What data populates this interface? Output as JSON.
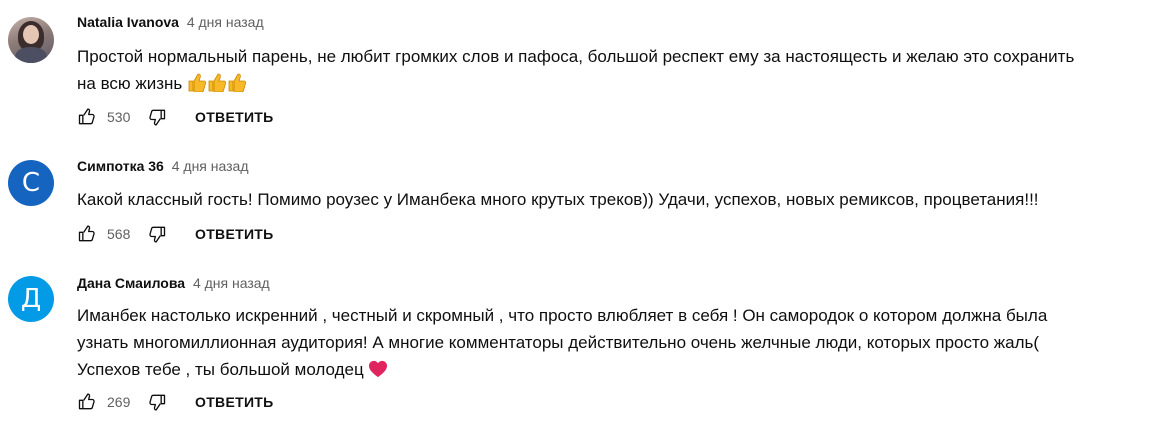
{
  "comments": [
    {
      "author": "Natalia Ivanova",
      "time": "4 дня назад",
      "avatar": {
        "type": "photo"
      },
      "lines": [
        "Простой нормальный парень, не любит громких слов и пафоса, большой респект ему за настоящесть и желаю это сохранить",
        "на всю жизнь"
      ],
      "emoji": "thumbs-up x3",
      "likes": "530",
      "reply_label": "ОТВЕТИТЬ"
    },
    {
      "author": "Симпотка 36",
      "time": "4 дня назад",
      "avatar": {
        "type": "letter",
        "letter": "С",
        "color": "#1565c0"
      },
      "lines": [
        "Какой классный гость! Помимо роузес у Иманбека много крутых треков)) Удачи,  успехов, новых ремиксов, процветания!!!"
      ],
      "likes": "568",
      "reply_label": "ОТВЕТИТЬ"
    },
    {
      "author": "Дана Смаилова",
      "time": "4 дня назад",
      "avatar": {
        "type": "letter",
        "letter": "Д",
        "color": "#039be5"
      },
      "lines": [
        "Иманбек настолько искренний , честный и скромный , что просто влюбляет в себя ! Он самородок о котором должна была",
        "узнать многомиллионная аудитория! А многие комментаторы действительно очень желчные люди, которых просто жаль(",
        "Успехов тебе , ты большой молодец"
      ],
      "emoji": "red-heart",
      "likes": "269",
      "reply_label": "ОТВЕТИТЬ"
    }
  ],
  "colors": {
    "text": "#0f0f0f",
    "secondary": "#606060",
    "heart": "#e0245e",
    "thumb": "#f7b928"
  },
  "icons": {
    "like": "thumbs-up-outline-icon",
    "dislike": "thumbs-down-outline-icon"
  }
}
